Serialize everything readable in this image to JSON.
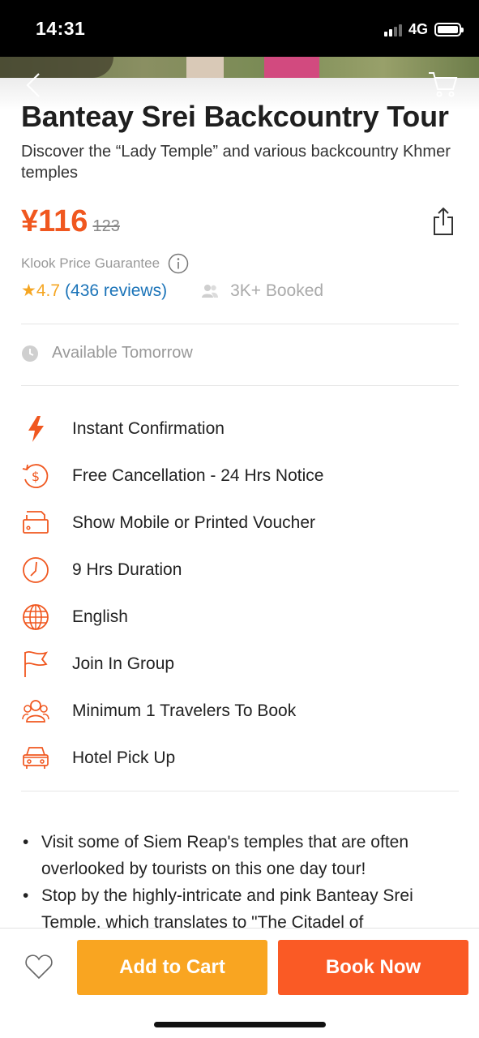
{
  "status_bar": {
    "time": "14:31",
    "network": "4G"
  },
  "header": {
    "back_icon": "chevron-left-icon",
    "cart_icon": "cart-icon"
  },
  "product": {
    "title": "Banteay Srei Backcountry Tour",
    "subtitle": "Discover the “Lady Temple” and various backcountry Khmer temples",
    "price": "¥116",
    "original_price": "123",
    "price_guarantee": "Klook Price Guarantee",
    "rating_star": "★",
    "rating": "4.7",
    "reviews": "(436 reviews)",
    "booked": "3K+ Booked",
    "availability": "Available Tomorrow"
  },
  "features": [
    {
      "icon": "lightning-icon",
      "label": "Instant Confirmation"
    },
    {
      "icon": "refund-icon",
      "label": "Free Cancellation - 24 Hrs Notice"
    },
    {
      "icon": "voucher-icon",
      "label": "Show Mobile or Printed Voucher"
    },
    {
      "icon": "clock-icon",
      "label": "9 Hrs Duration"
    },
    {
      "icon": "globe-icon",
      "label": "English"
    },
    {
      "icon": "flag-icon",
      "label": "Join In Group"
    },
    {
      "icon": "group-icon",
      "label": "Minimum 1 Travelers To Book"
    },
    {
      "icon": "car-icon",
      "label": "Hotel Pick Up"
    }
  ],
  "highlights": [
    "Visit some of Siem Reap's temples that are often overlooked by tourists on this one day tour!",
    "Stop by the highly-intricate and pink Banteay Srei Temple, which translates to \"The Citadel of"
  ],
  "bottom_bar": {
    "add_to_cart": "Add to Cart",
    "book_now": "Book Now"
  },
  "colors": {
    "accent": "#fa5a25",
    "cart_button": "#f9a521",
    "rating": "#f5a623",
    "link": "#1a73b8"
  }
}
